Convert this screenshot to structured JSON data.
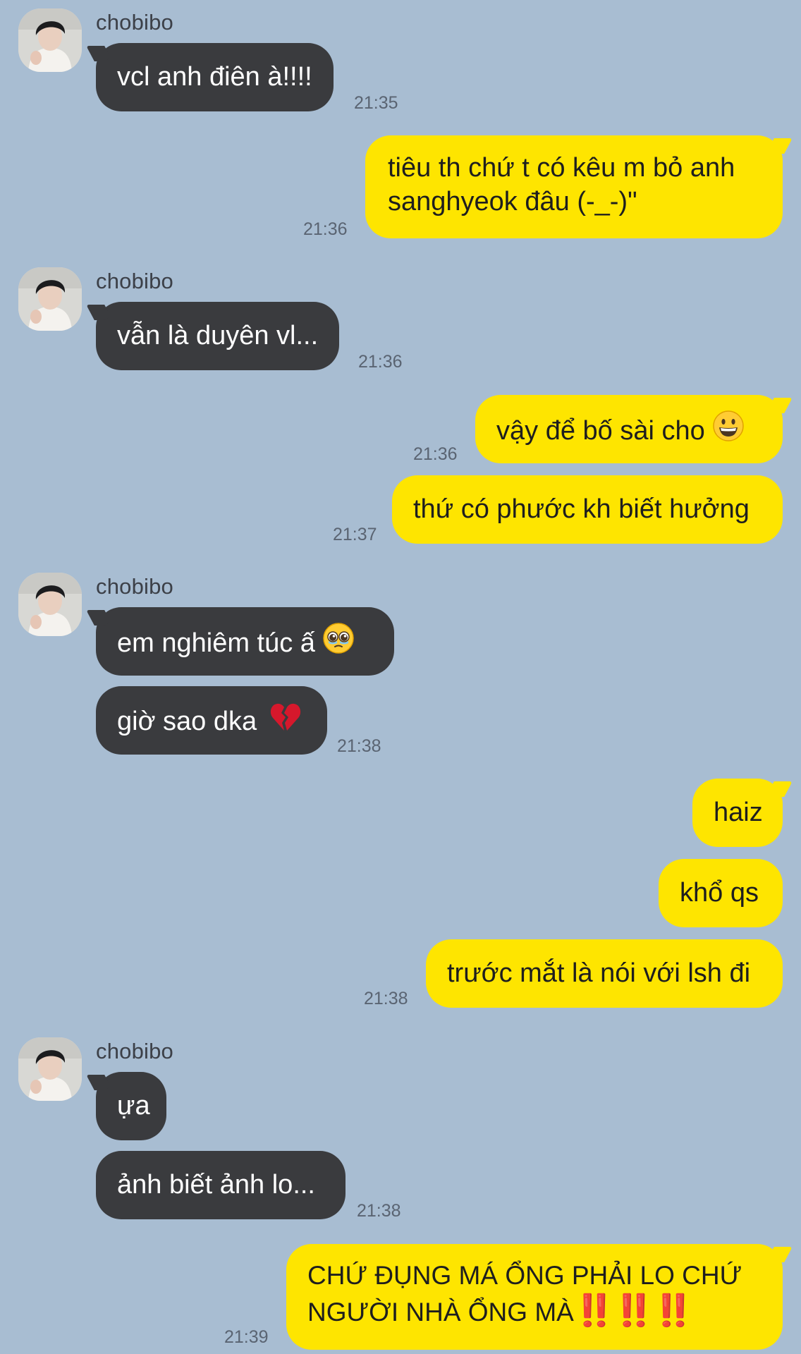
{
  "contact": {
    "name": "chobibo"
  },
  "colors": {
    "background": "#a8bdd2",
    "incoming_bubble": "#3a3b3e",
    "outgoing_bubble": "#fee500",
    "alert_mark": "#e8130e"
  },
  "messages": [
    {
      "text": "vcl anh điên à!!!!",
      "time": "21:35"
    },
    {
      "line1": "tiêu th chứ t có kêu m bỏ anh",
      "line2": "sanghyeok đâu (-_-)\"",
      "time": "21:36"
    },
    {
      "text": "vẫn là duyên vl...",
      "time": "21:36"
    },
    {
      "text": "vậy để bố sài cho",
      "emoji": "grinning-face-emoji",
      "time": "21:36"
    },
    {
      "text": "thứ có phước kh biết hưởng",
      "time": "21:37"
    },
    {
      "text": "em nghiêm túc ấ",
      "emoji": "pleading-face-emoji"
    },
    {
      "text": "giờ sao dka",
      "emoji": "broken-heart-emoji",
      "time": "21:38"
    },
    {
      "text": "haiz"
    },
    {
      "text": "khổ qs"
    },
    {
      "text": "trước mắt là nói với lsh đi",
      "time": "21:38"
    },
    {
      "text": "ựa"
    },
    {
      "text": "ảnh biết ảnh lo...",
      "time": "21:38"
    },
    {
      "line1": "CHỨ ĐỤNG MÁ ỔNG PHẢI LO CHỨ",
      "line2": "NGƯỜI NHÀ ỔNG MÀ",
      "marks": "‼️‼️‼️",
      "time": "21:39"
    }
  ]
}
